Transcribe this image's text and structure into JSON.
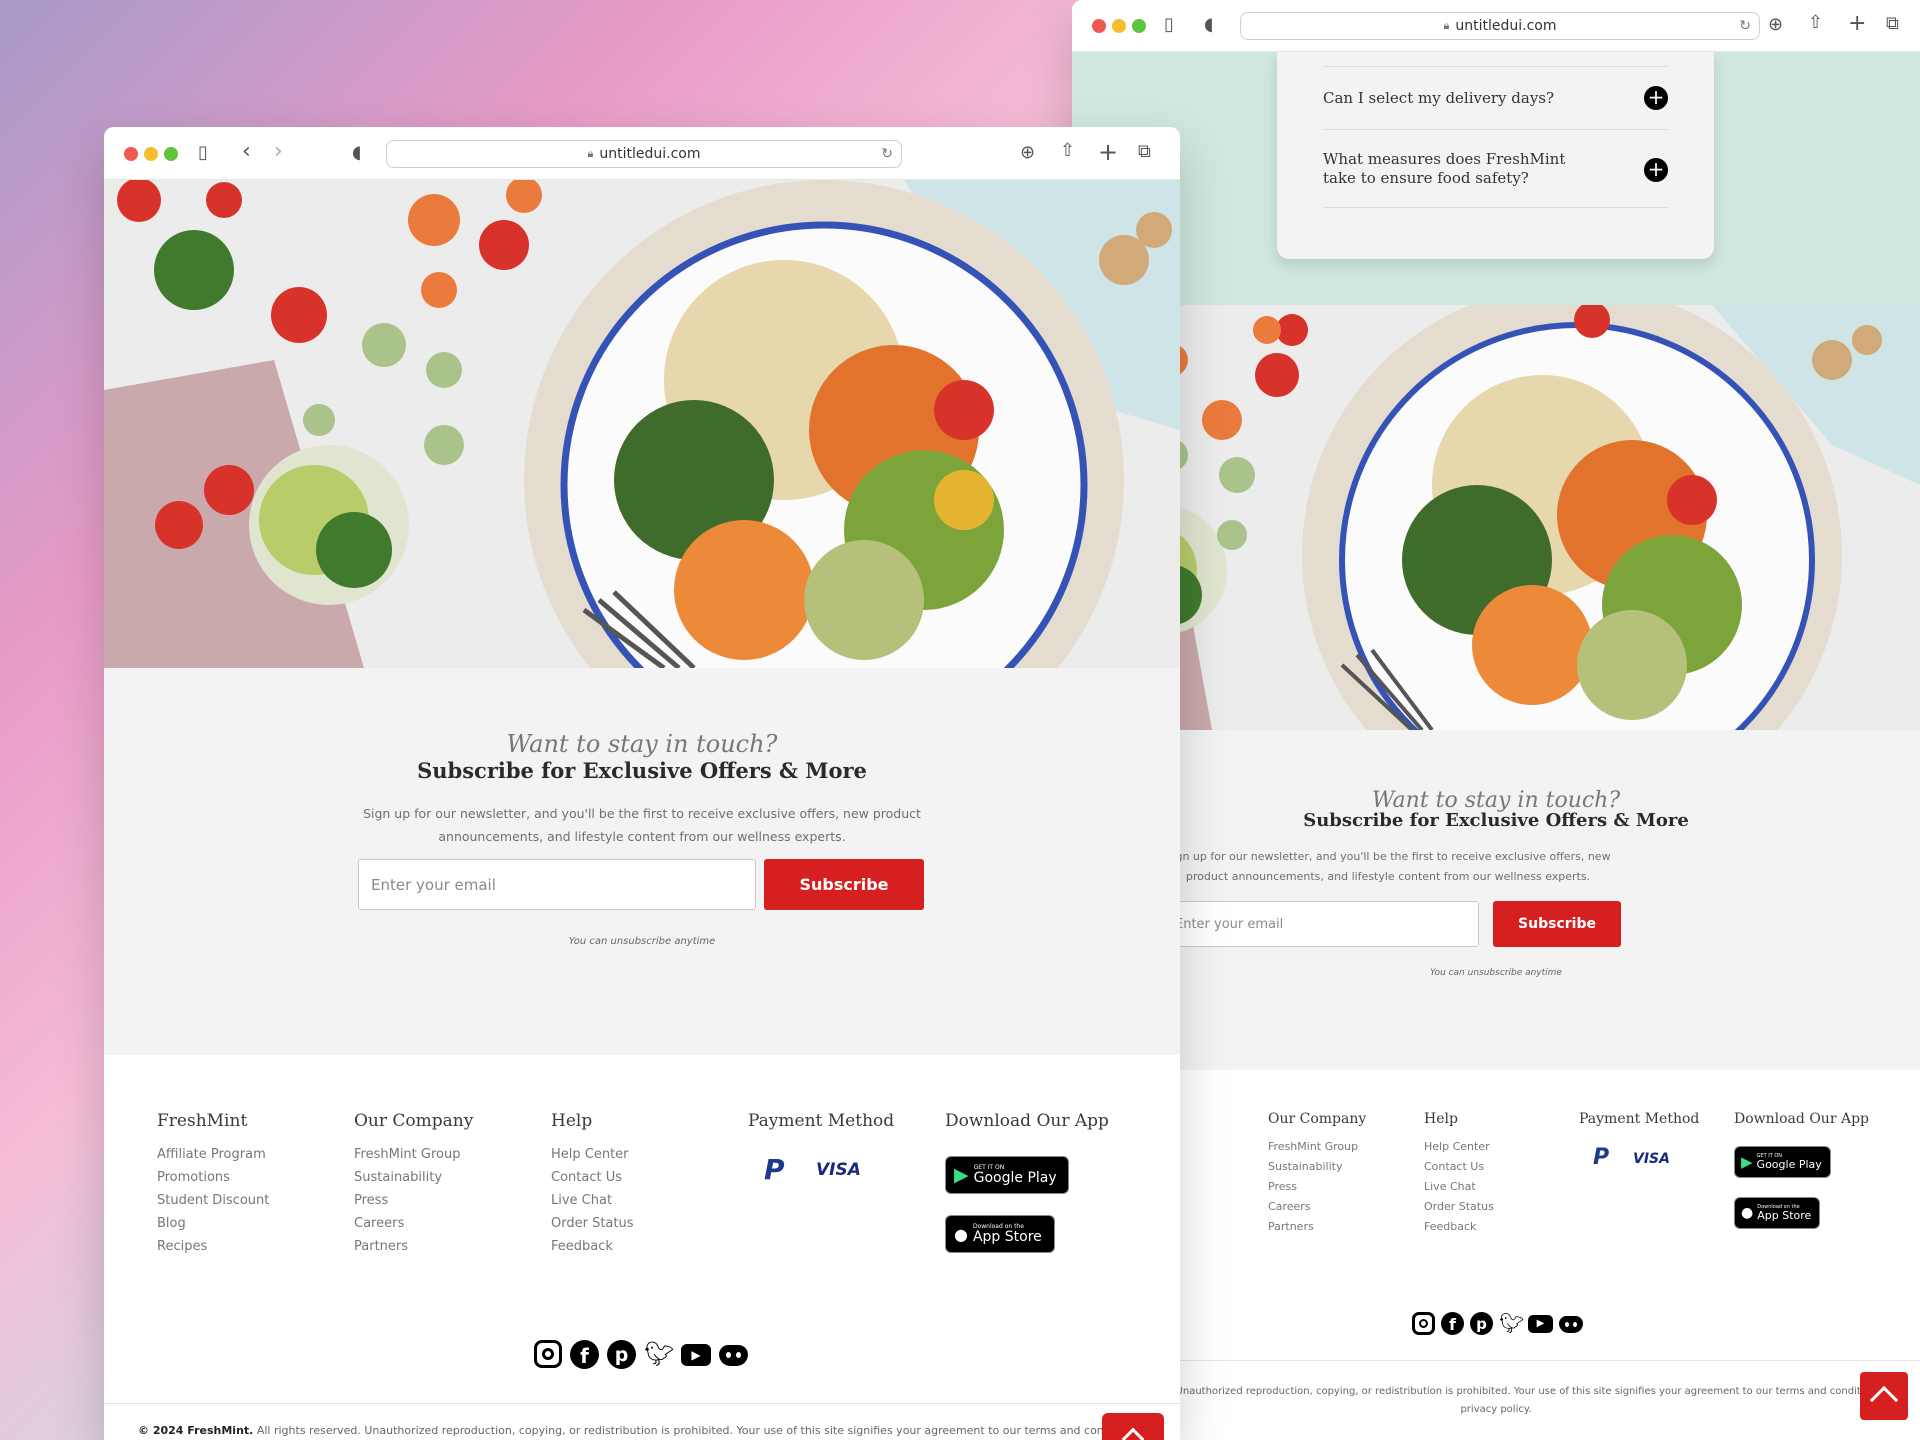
{
  "browser": {
    "url": "untitledui.com"
  },
  "faq": {
    "items": [
      {
        "question": "Can I select my delivery days?"
      },
      {
        "question": "What measures does FreshMint take to ensure food safety?"
      }
    ]
  },
  "newsletter": {
    "eyebrow": "Want to stay in touch?",
    "title": "Subscribe for Exclusive Offers & More",
    "description": "Sign up for our newsletter, and you'll be the first to receive exclusive offers, new product announcements, and lifestyle content from our wellness experts.",
    "email_placeholder": "Enter your email",
    "button": "Subscribe",
    "note": "You can unsubscribe anytime"
  },
  "footer": {
    "columns": [
      {
        "title": "FreshMint",
        "links": [
          "Affiliate Program",
          "Promotions",
          "Student Discount",
          "Blog",
          "Recipes"
        ]
      },
      {
        "title": "Our Company",
        "links": [
          "FreshMint Group",
          "Sustainability",
          "Press",
          "Careers",
          "Partners"
        ]
      },
      {
        "title": "Help",
        "links": [
          "Help Center",
          "Contact Us",
          "Live Chat",
          "Order Status",
          "Feedback"
        ]
      }
    ],
    "payment_title": "Payment Method",
    "payment_methods": [
      "PayPal",
      "VISA"
    ],
    "app_title": "Download Our App",
    "google_play_small": "GET IT ON",
    "google_play": "Google Play",
    "app_store_small": "Download on the",
    "app_store": "App Store",
    "social_icons": [
      "instagram-icon",
      "facebook-icon",
      "pinterest-icon",
      "twitter-icon",
      "youtube-icon",
      "discord-icon"
    ],
    "copyright_brand": "© 2024 FreshMint.",
    "copyright_text": "All rights reserved. Unauthorized reproduction, copying, or redistribution is prohibited. Your use of this site signifies your agreement to our terms and conditions and privacy policy.",
    "copyright_tail": "privacy policy."
  },
  "colors": {
    "accent": "#d61f1f",
    "page_bg": "#f3f3f3",
    "faq_bg": "#cfe7dd"
  }
}
